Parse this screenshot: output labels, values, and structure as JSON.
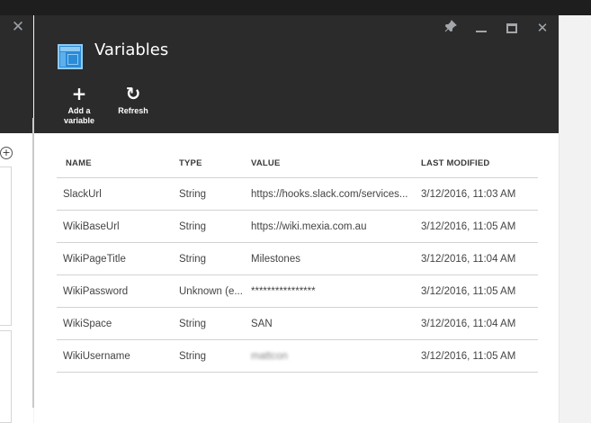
{
  "left_blade": {
    "close_glyph": "✕",
    "add_glyph": "+"
  },
  "blade": {
    "title": "Variables",
    "icon": "variables-icon",
    "window_controls": {
      "pin": "pin-icon",
      "minimize": "minimize-icon",
      "maximize": "maximize-icon",
      "close": "close-icon"
    },
    "toolbar": [
      {
        "label": "Add a\nvariable",
        "icon": "plus-icon",
        "glyph": "+"
      },
      {
        "label": "Refresh",
        "icon": "refresh-icon",
        "glyph": "↻"
      }
    ]
  },
  "table": {
    "columns": [
      "NAME",
      "TYPE",
      "VALUE",
      "LAST MODIFIED"
    ],
    "rows": [
      {
        "name": "SlackUrl",
        "type": "String",
        "value": "https://hooks.slack.com/services...",
        "modified": "3/12/2016, 11:03 AM"
      },
      {
        "name": "WikiBaseUrl",
        "type": "String",
        "value": "https://wiki.mexia.com.au",
        "modified": "3/12/2016, 11:05 AM"
      },
      {
        "name": "WikiPageTitle",
        "type": "String",
        "value": "Milestones",
        "modified": "3/12/2016, 11:04 AM"
      },
      {
        "name": "WikiPassword",
        "type": "Unknown (e...",
        "value": "****************",
        "modified": "3/12/2016, 11:05 AM"
      },
      {
        "name": "WikiSpace",
        "type": "String",
        "value": "SAN",
        "modified": "3/12/2016, 11:04 AM"
      },
      {
        "name": "WikiUsername",
        "type": "String",
        "value": "mattcon",
        "modified": "3/12/2016, 11:05 AM"
      }
    ]
  },
  "colors": {
    "header_bg": "#2b2b2b",
    "accent": "#2b8bd6",
    "topbar": "#1e1e1e"
  }
}
